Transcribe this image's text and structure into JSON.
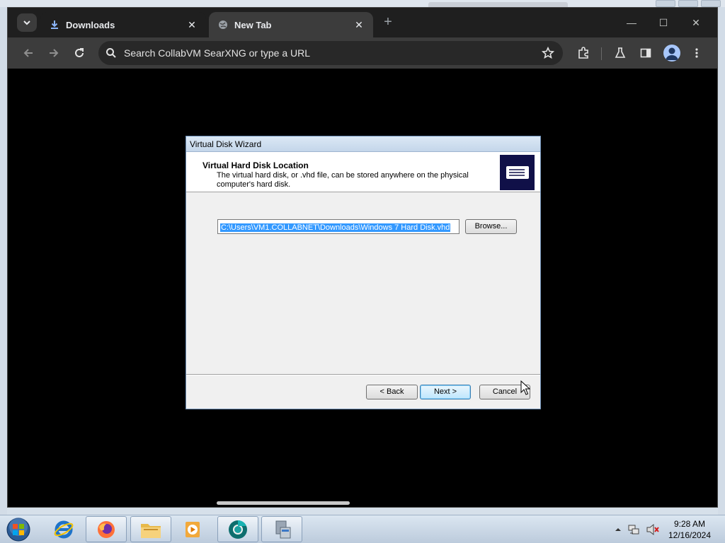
{
  "browser": {
    "tabs": [
      {
        "label": "Downloads",
        "active": true,
        "icon": "download-icon"
      },
      {
        "label": "New Tab",
        "active": false,
        "icon": "globe-icon"
      }
    ],
    "new_tab_symbol": "+",
    "omnibox_text": "Search CollabVM SearXNG or type a URL",
    "window_controls": {
      "minimize": "—",
      "maximize": "☐",
      "close": "✕"
    },
    "toolbar_icons": [
      "back-icon",
      "forward-icon",
      "reload-icon",
      "search-icon",
      "bookmark-star-icon",
      "extensions-icon",
      "labs-flask-icon",
      "side-panel-icon",
      "profile-icon",
      "menu-icon"
    ]
  },
  "dialog": {
    "title": "Virtual Disk Wizard",
    "heading": "Virtual Hard Disk Location",
    "description": "The virtual hard disk, or .vhd file, can be stored anywhere on the physical computer's hard disk.",
    "path_value": "C:\\Users\\VM1.COLLABNET\\Downloads\\Windows 7 Hard Disk.vhd",
    "browse_label": "Browse...",
    "back_label": "< Back",
    "next_label": "Next >",
    "cancel_label": "Cancel",
    "emblem_icon": "hard-disk-icon"
  },
  "taskbar": {
    "pinned": [
      "windows-start-orb-icon",
      "internet-explorer-icon",
      "firefox-icon",
      "file-explorer-icon",
      "media-player-icon",
      "chrome-browser-icon",
      "virtual-pc-icon"
    ],
    "tray_icons": [
      "tray-expand-icon",
      "network-icon",
      "volume-muted-icon"
    ],
    "time": "9:28 AM",
    "date": "12/16/2024"
  },
  "colors": {
    "browser_frame": "#1f1f1f",
    "toolbar": "#3c3c3c",
    "selection": "#3399ff",
    "dialog_emblem": "#101048"
  }
}
